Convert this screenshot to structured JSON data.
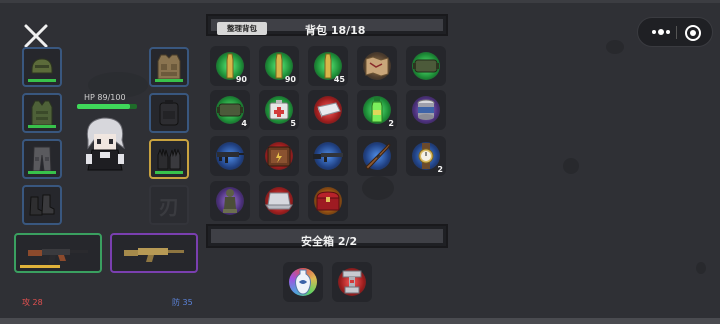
{
  "colors": {
    "background": "#2f3035",
    "slot_border_blue": "#39577f",
    "slot_border_gold": "#c9a340",
    "durability_green": "#38c24b",
    "attack_red": "#e05050",
    "defense_blue": "#5b82d8"
  },
  "character": {
    "hp_label": "HP 89/100",
    "hp_fraction": 0.89,
    "attack_label": "攻 28",
    "defense_label": "防 35"
  },
  "equipment": {
    "close_icon": "close-x-icon",
    "slots": [
      {
        "icon": "helmet-icon"
      },
      {
        "icon": "body-armor-icon"
      },
      {
        "icon": "tactical-pants-icon"
      },
      {
        "icon": "combat-boots-icon"
      },
      {
        "icon": "tactical-vest-icon"
      },
      {
        "icon": "backpack-icon"
      },
      {
        "icon": "gloves-icon"
      },
      {
        "icon": "empty-melee-slot-icon",
        "glyph": "刃"
      }
    ],
    "weapons": [
      {
        "icon": "ak-rifle-icon"
      },
      {
        "icon": "gold-rifle-icon"
      }
    ]
  },
  "backpack": {
    "sort_button": "整理背包",
    "title": "背包 18/18",
    "items": [
      {
        "icon": "rifle-ammo-icon",
        "count": "90"
      },
      {
        "icon": "rifle-ammo-icon",
        "count": "90"
      },
      {
        "icon": "rifle-ammo-icon",
        "count": "45"
      },
      {
        "icon": "treasure-map-icon",
        "count": ""
      },
      {
        "icon": "battery-canister-icon",
        "count": ""
      },
      {
        "icon": "battery-canister-icon",
        "count": "4"
      },
      {
        "icon": "first-aid-kit-icon",
        "count": "5"
      },
      {
        "icon": "silver-bar-icon",
        "count": ""
      },
      {
        "icon": "energy-drink-icon",
        "count": "2"
      },
      {
        "icon": "canned-food-icon",
        "count": ""
      },
      {
        "icon": "smg-icon",
        "count": ""
      },
      {
        "icon": "weapon-case-icon",
        "count": ""
      },
      {
        "icon": "shotgun-icon",
        "count": ""
      },
      {
        "icon": "bolt-action-rifle-icon",
        "count": ""
      },
      {
        "icon": "wristwatch-icon",
        "count": "2"
      },
      {
        "icon": "statue-icon",
        "count": ""
      },
      {
        "icon": "silver-laptop-icon",
        "count": ""
      },
      {
        "icon": "red-chest-icon",
        "count": ""
      }
    ]
  },
  "safe_box": {
    "title": "安全箱 2/2",
    "items": [
      {
        "icon": "porcelain-vase-icon"
      },
      {
        "icon": "hydraulic-press-icon"
      }
    ]
  },
  "mini_program_capsule": {
    "more_icon": "more-dots-icon",
    "close_icon": "target-close-icon"
  }
}
